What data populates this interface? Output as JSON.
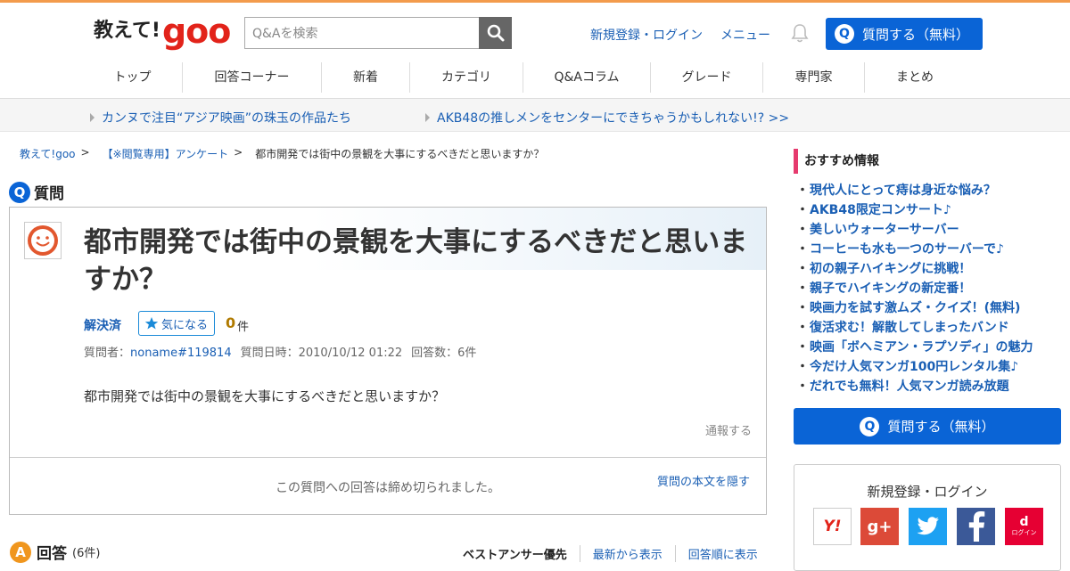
{
  "header": {
    "logo_text": "教えて!",
    "logo_brand": "goo",
    "search_placeholder": "Q&Aを検索",
    "register_login": "新規登録・ログイン",
    "menu": "メニュー",
    "ask_button": "質問する（無料）"
  },
  "nav": {
    "items": [
      {
        "label": "トップ"
      },
      {
        "label": "回答コーナー"
      },
      {
        "label": "新着"
      },
      {
        "label": "カテゴリ"
      },
      {
        "label": "Q&Aコラム"
      },
      {
        "label": "グレード"
      },
      {
        "label": "専門家"
      },
      {
        "label": "まとめ"
      }
    ]
  },
  "promo": {
    "link1": "カンヌで注目“アジア映画”の珠玉の作品たち",
    "link2": "AKB48の推しメンをセンターにできちゃうかもしれない!? >>"
  },
  "breadcrumb": {
    "item1": "教えて!goo",
    "item2": "【※閲覧専用】アンケート",
    "sep": ">",
    "current": "都市開発では街中の景観を大事にするべきだと思いますか？"
  },
  "question": {
    "section_badge": "Q",
    "section_title": "質問",
    "title": "都市開発では街中の景観を大事にするべきだと思いますか？",
    "status": "解決済",
    "like_label": "気になる",
    "like_count": "0",
    "like_unit": "件",
    "meta_asker_label": "質問者：",
    "meta_asker": "noname#119814",
    "meta_date": "質問日時：2010/10/12 01:22",
    "meta_answers": "回答数：6件",
    "body": "都市開発では街中の景観を大事にするべきだと思いますか？",
    "report": "通報する",
    "closed_message": "この質問への回答は締め切られました。",
    "hide_body": "質問の本文を隠す"
  },
  "answers": {
    "section_badge": "A",
    "section_title": "回答",
    "count": "(6件)",
    "sort_options": [
      "ベストアンサー優先",
      "最新から表示",
      "回答順に表示"
    ]
  },
  "sidebar": {
    "heading": "おすすめ情報",
    "links": [
      "現代人にとって痔は身近な悩み？",
      "AKB48限定コンサート♪",
      "美しいウォーターサーバー",
      "コーヒーも水も一つのサーバーで♪",
      "初の親子ハイキングに挑戦！",
      "親子でハイキングの新定番！",
      "映画力を試す激ムズ・クイズ！(無料)",
      "復活求む！解散してしまったバンド",
      "映画「ボヘミアン・ラプソディ」の魅力",
      "今だけ人気マンガ100円レンタル集♪",
      "だれでも無料！人気マンガ読み放題"
    ],
    "ask_button": "質問する（無料）",
    "login_title": "新規登録・ログイン",
    "sns_yahoo": "Y!",
    "sns_google": "g+",
    "sns_docomo_label": "ログイン"
  },
  "colors": {
    "brand_red": "#e2231a",
    "primary_blue": "#0a64d6",
    "link_blue": "#1a5fb4",
    "accent_pink": "#e63a6e",
    "top_line_orange": "#f39b4c"
  }
}
